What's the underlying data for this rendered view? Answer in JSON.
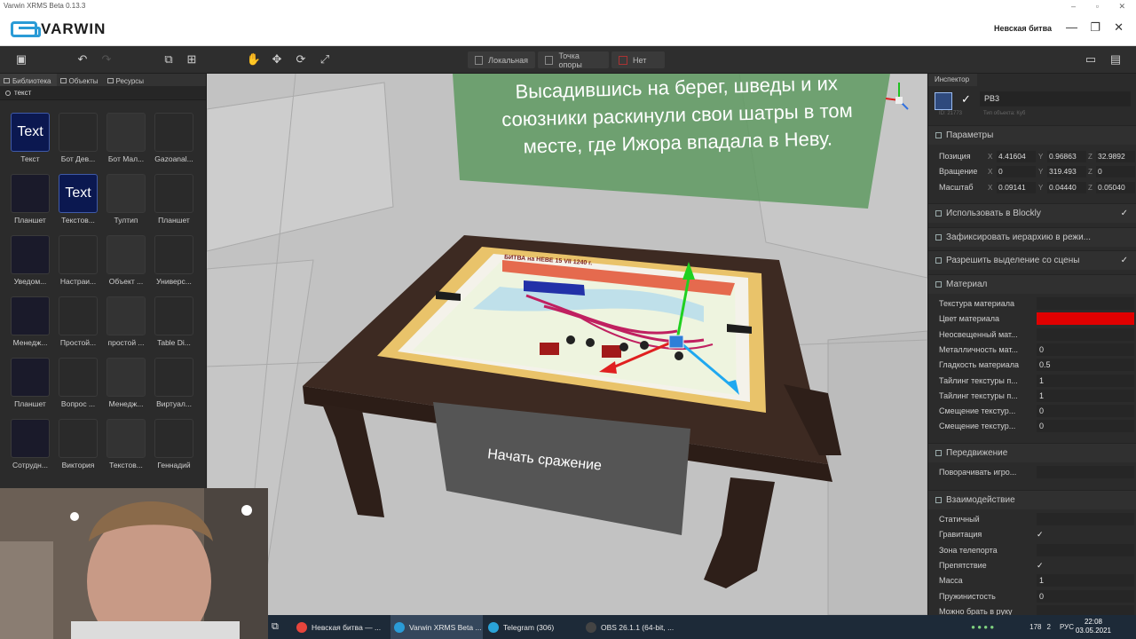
{
  "os_window": {
    "title": "Varwin XRMS Beta 0.13.3"
  },
  "header": {
    "logo_text": "VARWIN",
    "project_name": "Невская битва"
  },
  "toolbar": {
    "groups": [
      {
        "label": "Локальная"
      },
      {
        "label": "Точка опоры"
      },
      {
        "label": "Нет"
      }
    ]
  },
  "left_panel": {
    "tabs": [
      "Библиотека",
      "Объекты",
      "Ресурсы"
    ],
    "search_value": "текст",
    "items": [
      {
        "label": "Текст",
        "thumb": "Text"
      },
      {
        "label": "Бот Дев..."
      },
      {
        "label": "Бот Мал..."
      },
      {
        "label": "Gazoanal..."
      },
      {
        "label": "Планшет"
      },
      {
        "label": "Текстов...",
        "thumb": "Text"
      },
      {
        "label": "Тултип"
      },
      {
        "label": "Планшет"
      },
      {
        "label": "Уведом..."
      },
      {
        "label": "Настраи..."
      },
      {
        "label": "Объект ..."
      },
      {
        "label": "Универс..."
      },
      {
        "label": "Менедж..."
      },
      {
        "label": "Простой..."
      },
      {
        "label": "простой ..."
      },
      {
        "label": "Table Di..."
      },
      {
        "label": "Планшет"
      },
      {
        "label": "Вопрос ..."
      },
      {
        "label": "Менедж..."
      },
      {
        "label": "Виртуал..."
      },
      {
        "label": "Сотрудн..."
      },
      {
        "label": "Виктория"
      },
      {
        "label": "Текстов..."
      },
      {
        "label": "Геннадий"
      }
    ]
  },
  "viewport": {
    "banner_lines": [
      "Высадившись на берег, шведы и их",
      "союзники раскинули свои шатры в том",
      "месте, где Ижора впадала в Неву."
    ],
    "table_label": "Начать сражение",
    "map_title": "БИТВА на НЕВЕ 15 VII 1240 г."
  },
  "inspector": {
    "tab": "Инспектор",
    "object_name": "PB3",
    "object_id": "ID: 21773",
    "object_type": "Тип объекта: Куб",
    "params_title": "Параметры",
    "position": {
      "label": "Позиция",
      "x": "4.41604",
      "y": "0.96863",
      "z": "32.9892"
    },
    "rotation": {
      "label": "Вращение",
      "x": "0",
      "y": "319.493",
      "z": "0"
    },
    "scale": {
      "label": "Масштаб",
      "x": "0.09141",
      "y": "0.04440",
      "z": "0.05040"
    },
    "toggles": [
      {
        "label": "Использовать в Blockly",
        "checked": "✓"
      },
      {
        "label": "Зафиксировать иерархию в режи...",
        "checked": ""
      },
      {
        "label": "Разрешить выделение со сцены",
        "checked": "✓"
      }
    ],
    "material_title": "Материал",
    "material_props": [
      {
        "label": "Текстура материала",
        "value": ""
      },
      {
        "label": "Цвет материала",
        "value": ""
      },
      {
        "label": "Неосвещенный мат...",
        "value": ""
      },
      {
        "label": "Металличность мат...",
        "value": "0"
      },
      {
        "label": "Гладкость материала",
        "value": "0.5"
      },
      {
        "label": "Тайлинг текстуры п...",
        "value": "1"
      },
      {
        "label": "Тайлинг текстуры п...",
        "value": "1"
      },
      {
        "label": "Смещение текстур...",
        "value": "0"
      },
      {
        "label": "Смещение текстур...",
        "value": "0"
      }
    ],
    "material_color": "#e00000",
    "movement_title": "Передвижение",
    "movement_props": [
      {
        "label": "Поворачивать игро...",
        "value": ""
      }
    ],
    "interaction_title": "Взаимодействие",
    "interaction_props": [
      {
        "label": "Статичный",
        "value": ""
      },
      {
        "label": "Гравитация",
        "value": "✓"
      },
      {
        "label": "Зона телепорта",
        "value": ""
      },
      {
        "label": "Препятствие",
        "value": "✓"
      },
      {
        "label": "Масса",
        "value": "1"
      },
      {
        "label": "Пружинистость",
        "value": "0"
      },
      {
        "label": "Можно брать в руку",
        "value": ""
      }
    ]
  },
  "taskbar": {
    "tasks": [
      {
        "label": "Невская битва — ...",
        "color": "#e8453c"
      },
      {
        "label": "Varwin XRMS Beta ...",
        "color": "#2a9bd6"
      },
      {
        "label": "Telegram (306)",
        "color": "#2aa3d8"
      },
      {
        "label": "OBS 26.1.1 (64-bit, ...",
        "color": "#444444"
      }
    ],
    "tray_counts": [
      "178",
      "2"
    ],
    "lang": "РУС",
    "time": "22:08",
    "date": "03.05.2021"
  }
}
